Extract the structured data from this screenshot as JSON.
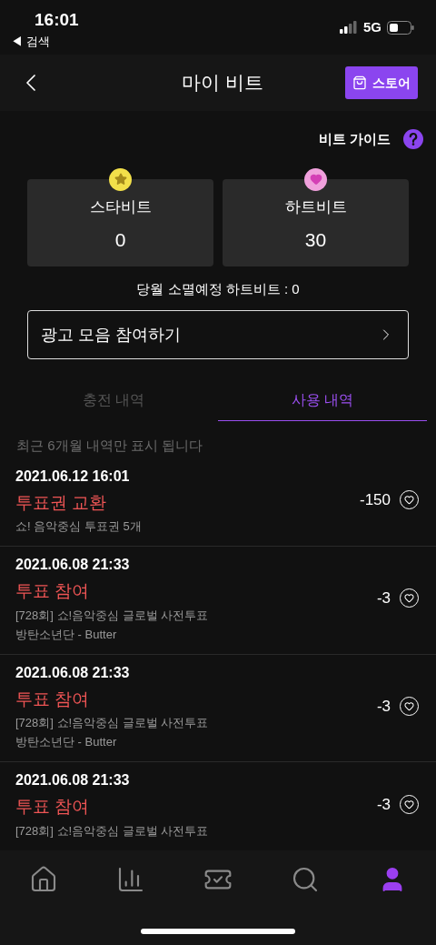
{
  "status_bar": {
    "time": "16:01",
    "back_label": "◀ 검색",
    "network": "5G"
  },
  "header": {
    "title": "마이 비트",
    "store_button": "스토어"
  },
  "guide": {
    "label": "비트 가이드"
  },
  "balances": [
    {
      "kind": "star",
      "label": "스타비트",
      "value": "0"
    },
    {
      "kind": "heart",
      "label": "하트비트",
      "value": "30"
    }
  ],
  "expiring_note": "당월 소멸예정 하트비트 : 0",
  "ad_button": "광고 모음 참여하기",
  "tabs": [
    {
      "label": "충전 내역",
      "selected": false
    },
    {
      "label": "사용 내역",
      "selected": true
    }
  ],
  "notice": "최근 6개월 내역만 표시 됩니다",
  "history": [
    {
      "date": "2021.06.12 16:01",
      "title": "투표권 교환",
      "lines": [
        "쇼! 음악중심 투표권 5개"
      ],
      "amount": "-150"
    },
    {
      "date": "2021.06.08 21:33",
      "title": "투표 참여",
      "lines": [
        "[728회] 쇼!음악중심 글로벌 사전투표",
        "방탄소년단 - Butter"
      ],
      "amount": "-3"
    },
    {
      "date": "2021.06.08 21:33",
      "title": "투표 참여",
      "lines": [
        "[728회] 쇼!음악중심 글로벌 사전투표",
        "방탄소년단 - Butter"
      ],
      "amount": "-3"
    },
    {
      "date": "2021.06.08 21:33",
      "title": "투표 참여",
      "lines": [
        "[728회] 쇼!음악중심 글로벌 사전투표"
      ],
      "amount": "-3"
    }
  ],
  "bottom_nav": [
    {
      "kind": "home",
      "selected": false
    },
    {
      "kind": "chart",
      "selected": false
    },
    {
      "kind": "vote",
      "selected": false
    },
    {
      "kind": "search",
      "selected": false
    },
    {
      "kind": "profile",
      "selected": true
    }
  ]
}
